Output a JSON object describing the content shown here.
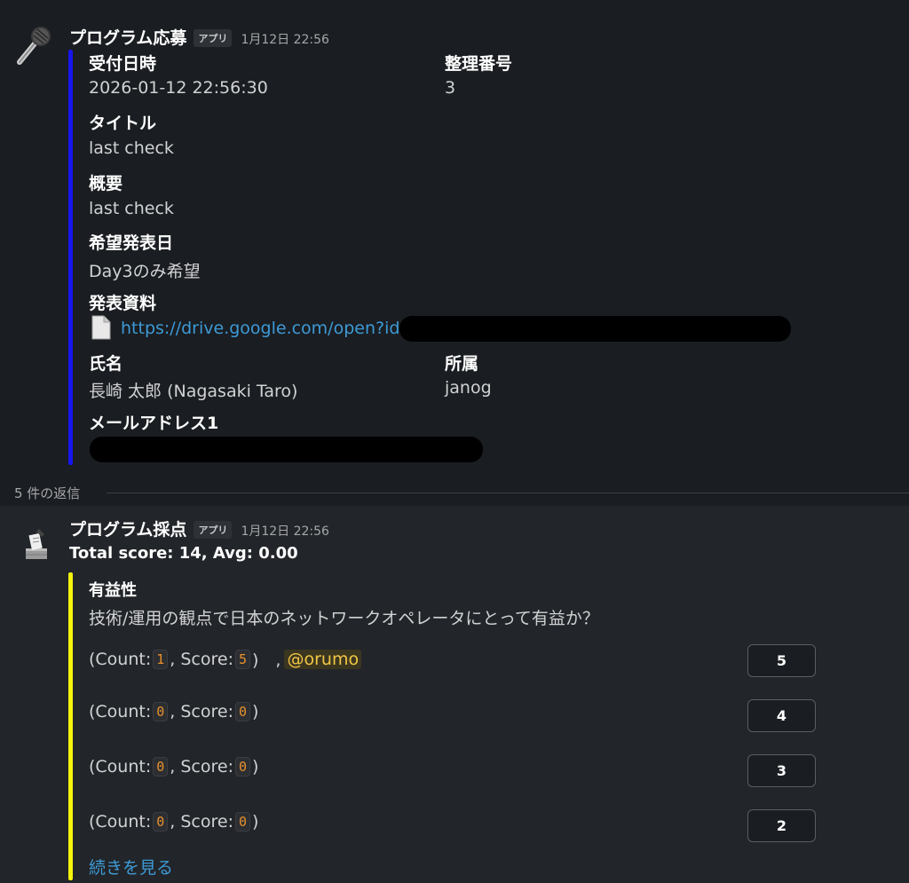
{
  "message1": {
    "sender": "プログラム応募",
    "badge": "アプリ",
    "time": "1月12日 22:56",
    "avatar_icon": "microphone-icon",
    "fields": {
      "received_label": "受付日時",
      "received_value": "2026-01-12 22:56:30",
      "number_label": "整理番号",
      "number_value": "3",
      "title_label": "タイトル",
      "title_value": "last check",
      "summary_label": "概要",
      "summary_value": "last check",
      "date_label": "希望発表日",
      "date_value": "Day3のみ希望",
      "material_label": "発表資料",
      "material_link": "https://drive.google.com/open?id=",
      "name_label": "氏名",
      "name_value": "長崎 太郎 (Nagasaki Taro)",
      "affiliation_label": "所属",
      "affiliation_value": "janog",
      "email_label": "メールアドレス1"
    },
    "accent_color": "#1616ec"
  },
  "thread": {
    "replies_label": "5 件の返信"
  },
  "message2": {
    "sender": "プログラム採点",
    "badge": "アプリ",
    "time": "1月12日 22:56",
    "avatar_icon": "ballot-box-icon",
    "score_summary": "Total score: 14, Avg: 0.00",
    "section_title": "有益性",
    "question": "技術/運用の観点で日本のネットワークオペレータにとって有益か？",
    "accent_color": "#f5f30c",
    "rows": [
      {
        "count_prefix": "(Count: ",
        "count": "1",
        "score_prefix": ", Score: ",
        "score": "5",
        "suffix": ")　,",
        "mention": "@orumo",
        "button": "5"
      },
      {
        "count_prefix": "(Count: ",
        "count": "0",
        "score_prefix": ", Score: ",
        "score": "0",
        "suffix": ")",
        "mention": "",
        "button": "4"
      },
      {
        "count_prefix": "(Count: ",
        "count": "0",
        "score_prefix": ", Score: ",
        "score": "0",
        "suffix": ")",
        "mention": "",
        "button": "3"
      },
      {
        "count_prefix": "(Count: ",
        "count": "0",
        "score_prefix": ", Score: ",
        "score": "0",
        "suffix": ")",
        "mention": "",
        "button": "2"
      }
    ],
    "show_more": "続きを見る"
  }
}
